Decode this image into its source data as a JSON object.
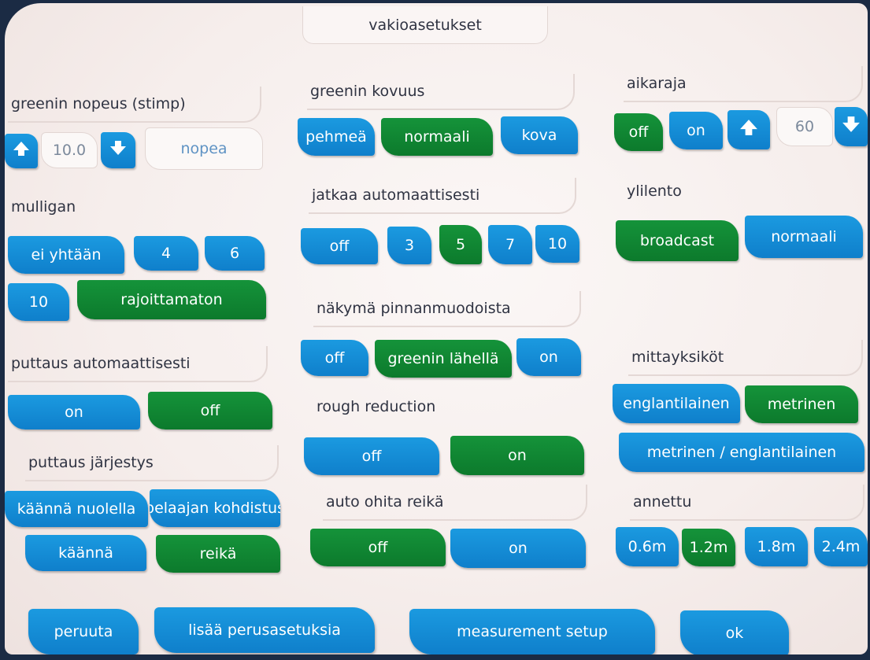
{
  "title": "vakioasetukset",
  "greenin_nopeus": {
    "label": "greenin nopeus (stimp)",
    "value": "10.0",
    "description": "nopea",
    "up_icon": "arrow-up-icon",
    "down_icon": "arrow-down-icon"
  },
  "greenin_kovuus": {
    "label": "greenin kovuus",
    "options": [
      "pehmeä",
      "normaali",
      "kova"
    ],
    "selected": "normaali"
  },
  "aikaraja": {
    "label": "aikaraja",
    "off": "off",
    "on": "on",
    "selected": "off",
    "value": "60"
  },
  "mulligan": {
    "label": "mulligan",
    "options": [
      "ei yhtään",
      "4",
      "6",
      "10",
      "rajoittamaton"
    ],
    "selected": "rajoittamaton"
  },
  "jatkaa": {
    "label": "jatkaa automaattisesti",
    "options": [
      "off",
      "3",
      "5",
      "7",
      "10"
    ],
    "selected": "5"
  },
  "ylilento": {
    "label": "ylilento",
    "options": [
      "broadcast",
      "normaali"
    ],
    "selected": "broadcast"
  },
  "nakyma": {
    "label": "näkymä pinnanmuodoista",
    "options": [
      "off",
      "greenin lähellä",
      "on"
    ],
    "selected": "greenin lähellä"
  },
  "puttaus_auto": {
    "label": "puttaus automaattisesti",
    "options": [
      "on",
      "off"
    ],
    "selected": "off"
  },
  "rough": {
    "label": "rough reduction",
    "options": [
      "off",
      "on"
    ],
    "selected": "on"
  },
  "mittayksikot": {
    "label": "mittayksiköt",
    "options": [
      "englantilainen",
      "metrinen",
      "metrinen / englantilainen"
    ],
    "selected": "metrinen"
  },
  "puttaus_jarjestys": {
    "label": "puttaus järjestys",
    "options": [
      "käännä nuolella",
      "pelaajan kohdistus",
      "käännä",
      "reikä"
    ],
    "selected": "reikä"
  },
  "auto_ohita": {
    "label": "auto ohita reikä",
    "options": [
      "off",
      "on"
    ],
    "selected": "off"
  },
  "annettu": {
    "label": "annettu",
    "options": [
      "0.6m",
      "1.2m",
      "1.8m",
      "2.4m"
    ],
    "selected": "1.2m"
  },
  "footer": {
    "peruuta": "peruuta",
    "lisaa": "lisää perusasetuksia",
    "measurement": "measurement setup",
    "ok": "ok"
  },
  "colors": {
    "blue": "#0f7fcb",
    "green": "#0c7a2c",
    "background": "#f6eeec",
    "bezel": "#1b2b44"
  }
}
